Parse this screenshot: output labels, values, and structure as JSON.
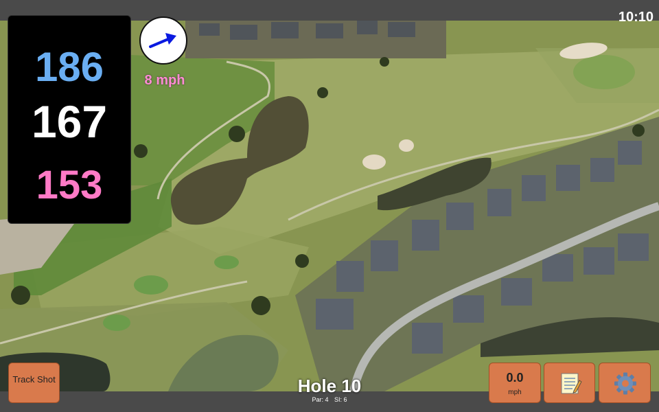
{
  "status_bar": {
    "time": "10:10"
  },
  "distances": {
    "back": "186",
    "middle": "167",
    "front": "153"
  },
  "wind": {
    "speed_label": "8 mph",
    "direction_icon": "arrow-icon",
    "arrow_color": "#0a1ae0"
  },
  "hole": {
    "title": "Hole 10",
    "par_label": "Par: 4",
    "si_label": "SI: 6"
  },
  "buttons": {
    "track_shot": "Track Shot",
    "speed_value": "0.0",
    "speed_unit": "mph",
    "notes_icon": "notepad-icon",
    "settings_icon": "gear-icon"
  },
  "colors": {
    "button_bg": "#d97a4c",
    "back_distance": "#6aaef2",
    "middle_distance": "#ffffff",
    "front_distance": "#ff7ac6",
    "wind_label": "#ff8cd2"
  }
}
